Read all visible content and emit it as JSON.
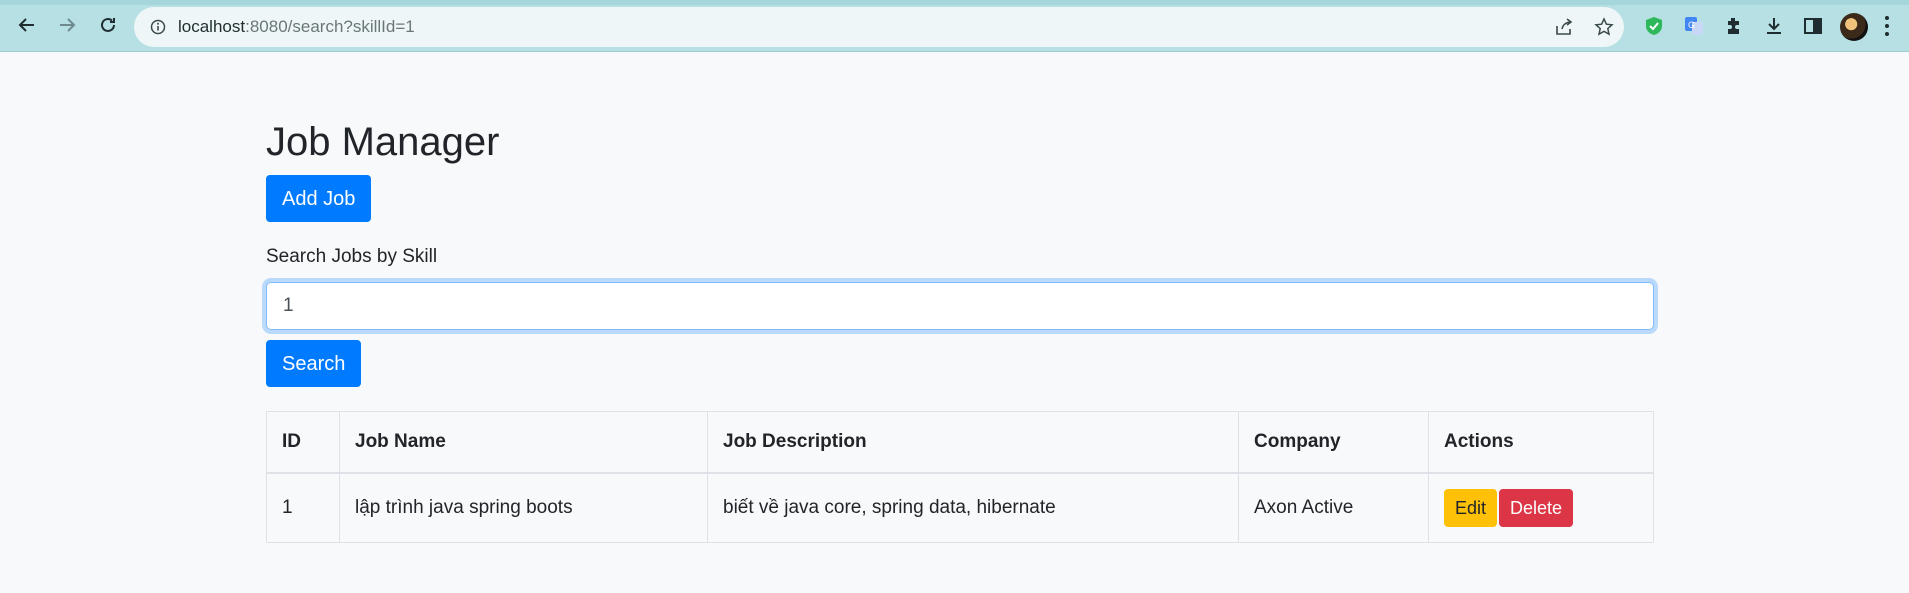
{
  "browser": {
    "url_host": "localhost",
    "url_rest": ":8080/search?skillId=1"
  },
  "page": {
    "title": "Job Manager",
    "add_button": "Add Job",
    "search_label": "Search Jobs by Skill",
    "search_value": "1",
    "search_button": "Search"
  },
  "table": {
    "headers": [
      "ID",
      "Job Name",
      "Job Description",
      "Company",
      "Actions"
    ],
    "rows": [
      {
        "id": "1",
        "name": "lập trình java spring boots",
        "description": "biết về java core, spring data, hibernate",
        "company": "Axon Active",
        "edit": "Edit",
        "delete": "Delete"
      }
    ]
  },
  "colors": {
    "primary": "#007bff",
    "warning": "#ffc107",
    "danger": "#dc3545",
    "chrome": "#b7e0e4"
  }
}
